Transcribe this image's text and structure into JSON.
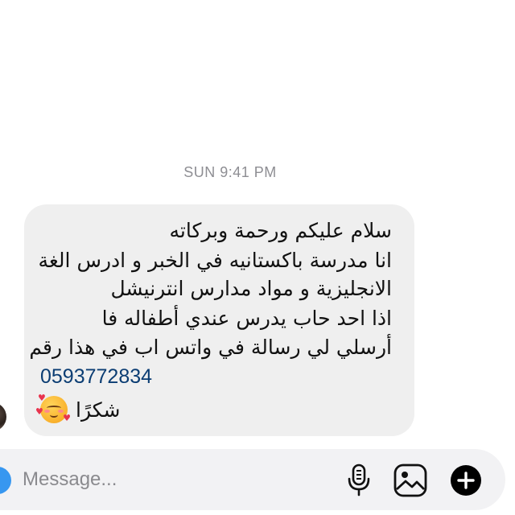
{
  "thread": {
    "timestamp": "SUN 9:41 PM"
  },
  "message": {
    "lines": [
      "سلام عليكم ورحمة وبركاته",
      "انا مدرسة باكستانيه في الخبر و ادرس الغة",
      "الانجليزية و مواد مدارس انترنيشل",
      "اذا احد حاب يدرس عندي أطفاله فا",
      "أرسلي لي رسالة في واتس اب في هذا رقم"
    ],
    "phone": "0593772834",
    "thanks": "شكرًا",
    "emoji": "smiling-face-with-hearts-icon"
  },
  "composer": {
    "placeholder": "Message..."
  },
  "colors": {
    "bubble": "#efefef",
    "link": "#0b3d73",
    "accent": "#3797f0",
    "timestamp": "#8e8e93"
  }
}
